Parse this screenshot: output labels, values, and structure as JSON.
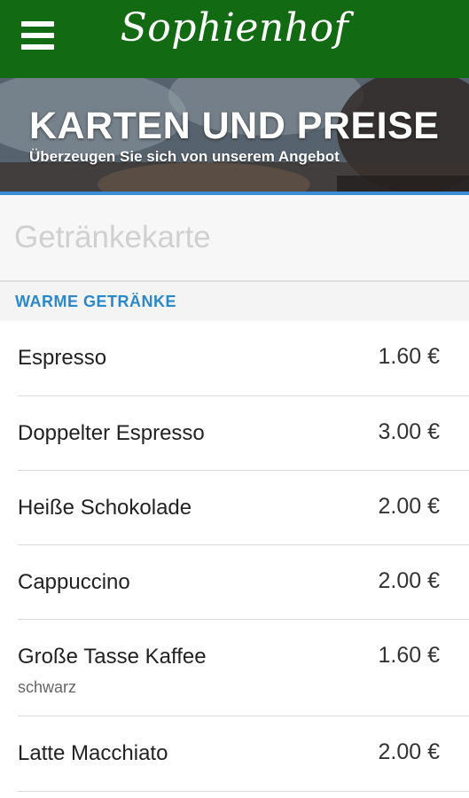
{
  "header": {
    "brand": "Sophienhof",
    "menu_icon": "hamburger-menu-icon",
    "background_color": "#126b12"
  },
  "hero": {
    "title": "KARTEN UND PREISE",
    "subtitle": "Überzeugen Sie sich von unserem Angebot",
    "accent_color": "#3b8ed3"
  },
  "search": {
    "placeholder": "Getränkekarte",
    "value": ""
  },
  "section": {
    "title": "WARME GETRÄNKE",
    "title_color": "#2b88c9"
  },
  "items": [
    {
      "name": "Espresso",
      "price": "1.60 €"
    },
    {
      "name": "Doppelter Espresso",
      "price": "3.00 €"
    },
    {
      "name": "Heiße Schokolade",
      "price": "2.00 €"
    },
    {
      "name": "Cappuccino",
      "price": "2.00 €"
    },
    {
      "name": "Große Tasse Kaffee",
      "price": "1.60 €",
      "description": "schwarz"
    },
    {
      "name": "Latte Macchiato",
      "price": "2.00 €"
    }
  ]
}
